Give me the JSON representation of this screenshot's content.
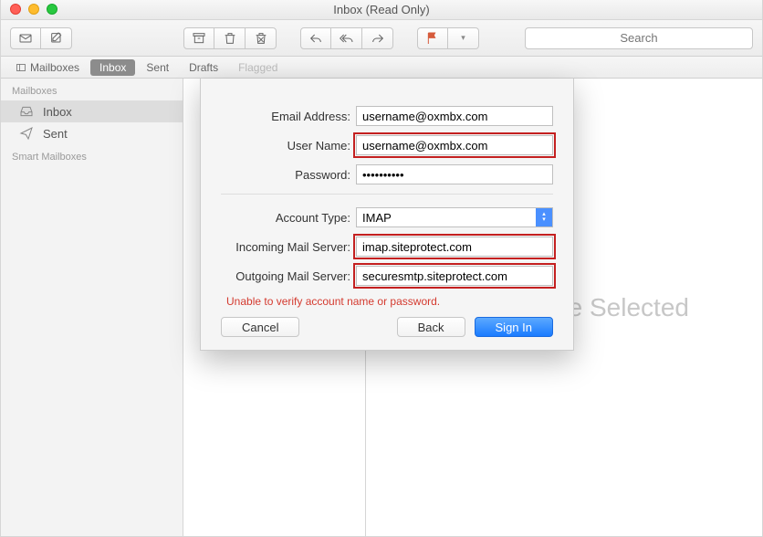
{
  "window": {
    "title": "Inbox (Read Only)"
  },
  "toolbar": {
    "search_placeholder": "Search"
  },
  "tabs": {
    "mailboxes": "Mailboxes",
    "inbox": "Inbox",
    "sent": "Sent",
    "drafts": "Drafts",
    "flagged": "Flagged"
  },
  "sidebar": {
    "header_mailboxes": "Mailboxes",
    "inbox": "Inbox",
    "sent": "Sent",
    "header_smart": "Smart Mailboxes"
  },
  "content": {
    "placeholder": "No Message Selected"
  },
  "sheet": {
    "labels": {
      "email": "Email Address:",
      "username": "User Name:",
      "password": "Password:",
      "account_type": "Account Type:",
      "incoming": "Incoming Mail Server:",
      "outgoing": "Outgoing Mail Server:"
    },
    "values": {
      "email": "username@oxmbx.com",
      "username": "username@oxmbx.com",
      "password": "••••••••••",
      "account_type": "IMAP",
      "incoming": "imap.siteprotect.com",
      "outgoing": "securesmtp.siteprotect.com"
    },
    "error": "Unable to verify account name or password.",
    "buttons": {
      "cancel": "Cancel",
      "back": "Back",
      "signin": "Sign In"
    }
  }
}
